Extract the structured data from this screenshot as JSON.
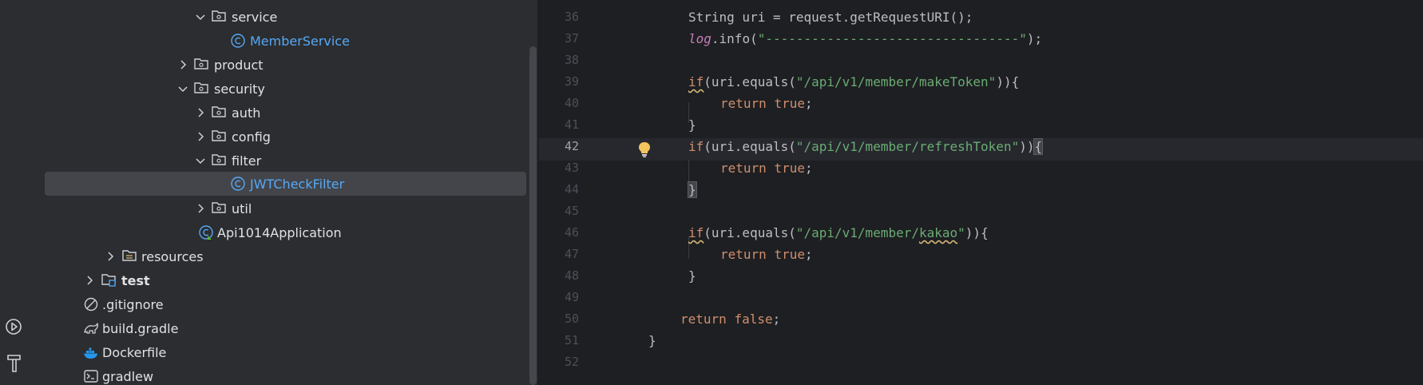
{
  "project_tree": {
    "items": [
      {
        "label": "service",
        "type": "folder",
        "expanded": true
      },
      {
        "label": "MemberService",
        "type": "class"
      },
      {
        "label": "product",
        "type": "folder",
        "expanded": false
      },
      {
        "label": "security",
        "type": "folder",
        "expanded": true
      },
      {
        "label": "auth",
        "type": "folder",
        "expanded": false
      },
      {
        "label": "config",
        "type": "folder",
        "expanded": false
      },
      {
        "label": "filter",
        "type": "folder",
        "expanded": true
      },
      {
        "label": "JWTCheckFilter",
        "type": "class",
        "selected": true
      },
      {
        "label": "util",
        "type": "folder",
        "expanded": false
      },
      {
        "label": "Api1014Application",
        "type": "spring-class"
      },
      {
        "label": "resources",
        "type": "resources-folder",
        "expanded": false
      },
      {
        "label": "test",
        "type": "test-folder",
        "expanded": false
      },
      {
        "label": ".gitignore",
        "type": "ignore-file"
      },
      {
        "label": "build.gradle",
        "type": "gradle-file"
      },
      {
        "label": "Dockerfile",
        "type": "docker-file"
      },
      {
        "label": "gradlew",
        "type": "shell-file"
      }
    ]
  },
  "editor": {
    "line_numbers": [
      "36",
      "37",
      "38",
      "39",
      "40",
      "41",
      "42",
      "43",
      "44",
      "45",
      "46",
      "47",
      "48",
      "49",
      "50",
      "51",
      "52"
    ],
    "current_line": "42",
    "lines": {
      "l36": {
        "a": "String uri = request.getRequestURI();"
      },
      "l37": {
        "field": "log",
        "a": ".info(",
        "str": "\"---------------------------------\"",
        "b": ");"
      },
      "l39": {
        "kw": "if",
        "a": "(uri.equals(",
        "str": "\"/api/v1/member/makeToken\"",
        "b": ")){"
      },
      "l40": {
        "kw": "return",
        "b": " ",
        "kw2": "true",
        "c": ";"
      },
      "l41": {
        "a": "}"
      },
      "l42": {
        "kw": "if",
        "a": "(uri.equals(",
        "str": "\"/api/v1/member/refreshToken\"",
        "b": "))",
        "brace": "{"
      },
      "l43": {
        "kw": "return",
        "b": " ",
        "kw2": "true",
        "c": ";"
      },
      "l44": {
        "brace": "}"
      },
      "l46": {
        "kw": "if",
        "a": "(uri.equals(",
        "str_a": "\"/api/v1/member/",
        "str_typo": "kakao",
        "str_b": "\"",
        "b": ")){"
      },
      "l47": {
        "kw": "return",
        "b": " ",
        "kw2": "true",
        "c": ";"
      },
      "l48": {
        "a": "}"
      },
      "l50": {
        "kw": "return",
        "b": " ",
        "kw2": "false",
        "c": ";"
      },
      "l51": {
        "a": "}"
      }
    }
  },
  "colors": {
    "background": "#1e1f22",
    "panel": "#2b2d30",
    "keyword": "#cf8e6d",
    "string": "#6aab73",
    "field": "#c77dbb",
    "class_link": "#56a8f5",
    "bulb": "#f2c55c"
  },
  "left_toolbar": {
    "icons": [
      "run-widget-icon",
      "build-hammer-icon"
    ]
  }
}
